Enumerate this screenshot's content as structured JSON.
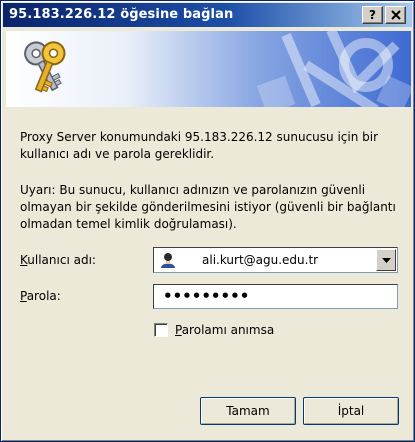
{
  "window": {
    "title": "95.183.226.12 öğesine bağlan",
    "help_label": "?",
    "close_label": "X"
  },
  "banner": {
    "icon": "keys-icon",
    "decoration": "network-globe-icon"
  },
  "messages": {
    "intro": "Proxy Server konumundaki 95.183.226.12 sunucusu için bir kullanıcı adı ve parola gereklidir.",
    "warning": "Uyarı: Bu sunucu, kullanıcı adınızın ve parolanızın güvenli olmayan bir şekilde gönderilmesini istiyor (güvenli bir bağlantı olmadan temel kimlik doğrulaması)."
  },
  "form": {
    "username_label_first": "K",
    "username_label_rest": "ullanıcı adı:",
    "username_value": "ali.kurt@agu.edu.tr",
    "username_icon": "user-icon",
    "password_label_first": "P",
    "password_label_rest": "arola:",
    "password_value": "•••••••••",
    "remember_label_first": "P",
    "remember_label_rest": "arolamı anımsa",
    "remember_checked": false
  },
  "buttons": {
    "ok": "Tamam",
    "cancel": "İptal"
  },
  "colors": {
    "title_bar": "#0a246a",
    "dialog_bg": "#ece9d8"
  }
}
